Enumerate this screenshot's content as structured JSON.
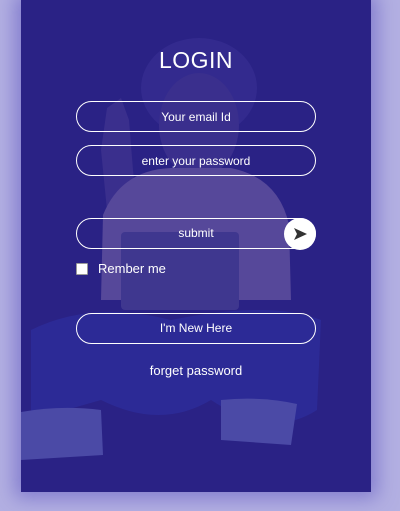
{
  "form": {
    "title": "LOGIN",
    "email_placeholder": "Your email Id",
    "password_placeholder": "enter your password",
    "submit_label": "submit",
    "remember_label": "Rember me",
    "new_here_label": "I'm New Here",
    "forget_label": "forget password"
  },
  "icons": {
    "send": "send-arrow-icon"
  },
  "colors": {
    "page_background": "#b3b0e2",
    "card_background": "#2a2285",
    "text": "#ffffff"
  }
}
